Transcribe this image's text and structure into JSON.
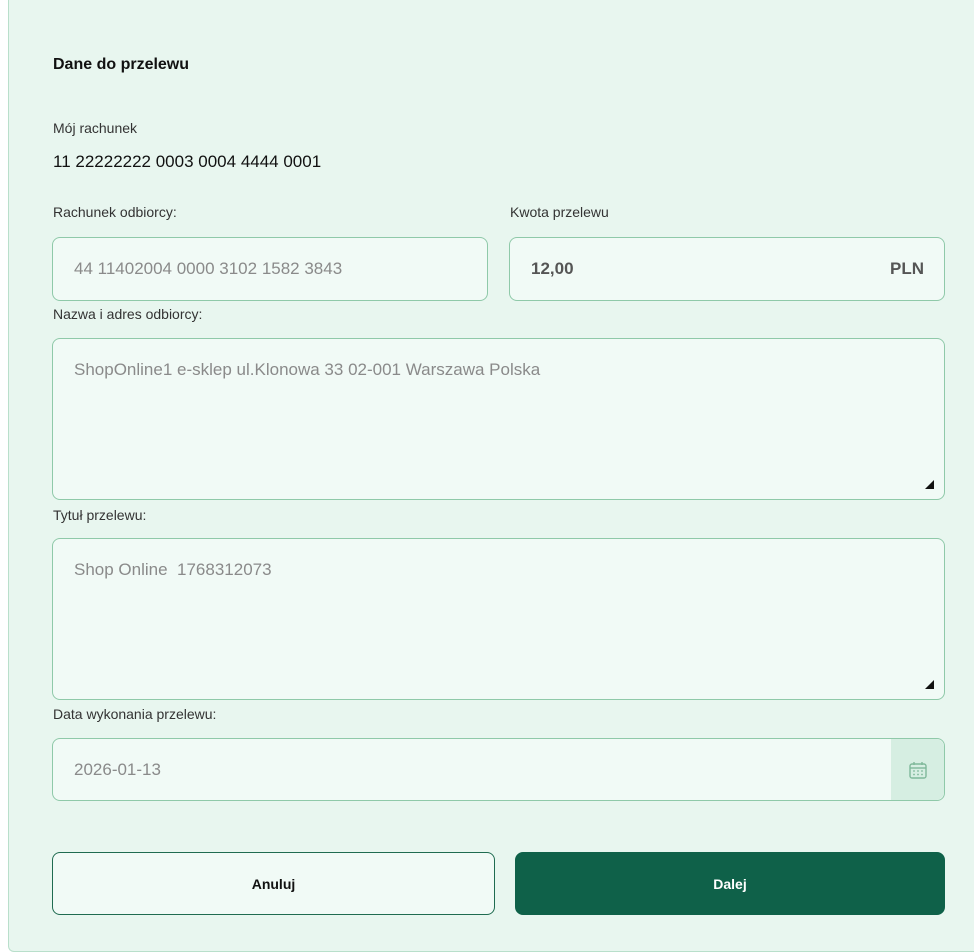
{
  "form": {
    "title": "Dane do przelewu",
    "my_account": {
      "label": "Mój rachunek",
      "value": "11 22222222 0003 0004 4444 0001"
    },
    "recipient_account": {
      "label": "Rachunek odbiorcy:",
      "value": "44 11402004 0000 3102 1582 3843"
    },
    "amount": {
      "label": "Kwota przelewu",
      "value": "12,00",
      "currency": "PLN"
    },
    "recipient_name": {
      "label": "Nazwa i adres odbiorcy:",
      "value": "ShopOnline1 e-sklep ul.Klonowa 33 02-001 Warszawa Polska"
    },
    "transfer_title": {
      "label": "Tytuł przelewu:",
      "value": "Shop Online  1768312073"
    },
    "execution_date": {
      "label": "Data wykonania przelewu:",
      "value": "2026-01-13",
      "icon": "calendar-icon"
    }
  },
  "buttons": {
    "cancel_label": "Anuluj",
    "next_label": "Dalej"
  },
  "colors": {
    "background": "#e8f6ef",
    "field_background": "#f1faf6",
    "field_border": "#8fc9a9",
    "primary": "#0f6149"
  }
}
